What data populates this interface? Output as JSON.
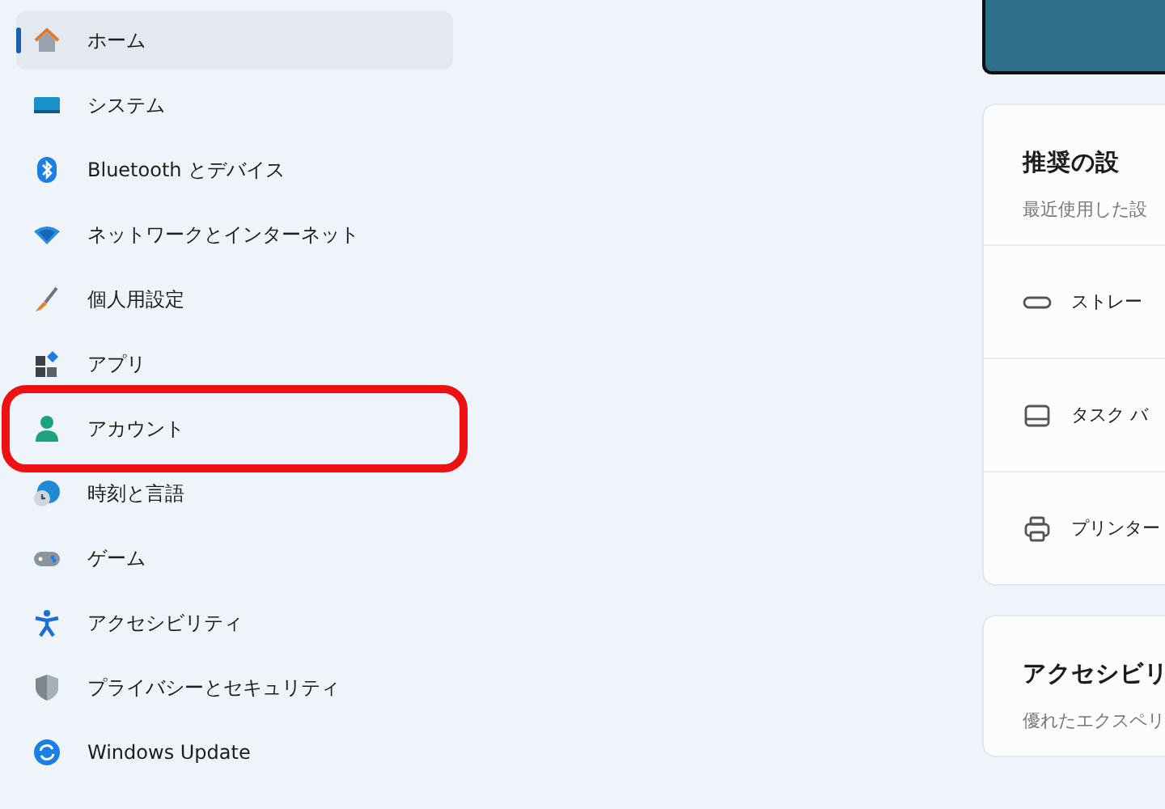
{
  "sidebar": {
    "items": [
      {
        "label": "ホーム",
        "selected": true,
        "highlighted": false
      },
      {
        "label": "システム",
        "selected": false,
        "highlighted": false
      },
      {
        "label": "Bluetooth とデバイス",
        "selected": false,
        "highlighted": false
      },
      {
        "label": "ネットワークとインターネット",
        "selected": false,
        "highlighted": false
      },
      {
        "label": "個人用設定",
        "selected": false,
        "highlighted": false
      },
      {
        "label": "アプリ",
        "selected": false,
        "highlighted": false
      },
      {
        "label": "アカウント",
        "selected": false,
        "highlighted": true
      },
      {
        "label": "時刻と言語",
        "selected": false,
        "highlighted": false
      },
      {
        "label": "ゲーム",
        "selected": false,
        "highlighted": false
      },
      {
        "label": "アクセシビリティ",
        "selected": false,
        "highlighted": false
      },
      {
        "label": "プライバシーとセキュリティ",
        "selected": false,
        "highlighted": false
      },
      {
        "label": "Windows Update",
        "selected": false,
        "highlighted": false
      }
    ]
  },
  "recommended": {
    "title": "推奨の設",
    "subtitle": "最近使用した設",
    "rows": [
      {
        "label": "ストレー"
      },
      {
        "label": "タスク バ"
      },
      {
        "label": "プリンター"
      }
    ]
  },
  "accessibility": {
    "title": "アクセシビリ",
    "subtitle": "優れたエクスペリ"
  }
}
